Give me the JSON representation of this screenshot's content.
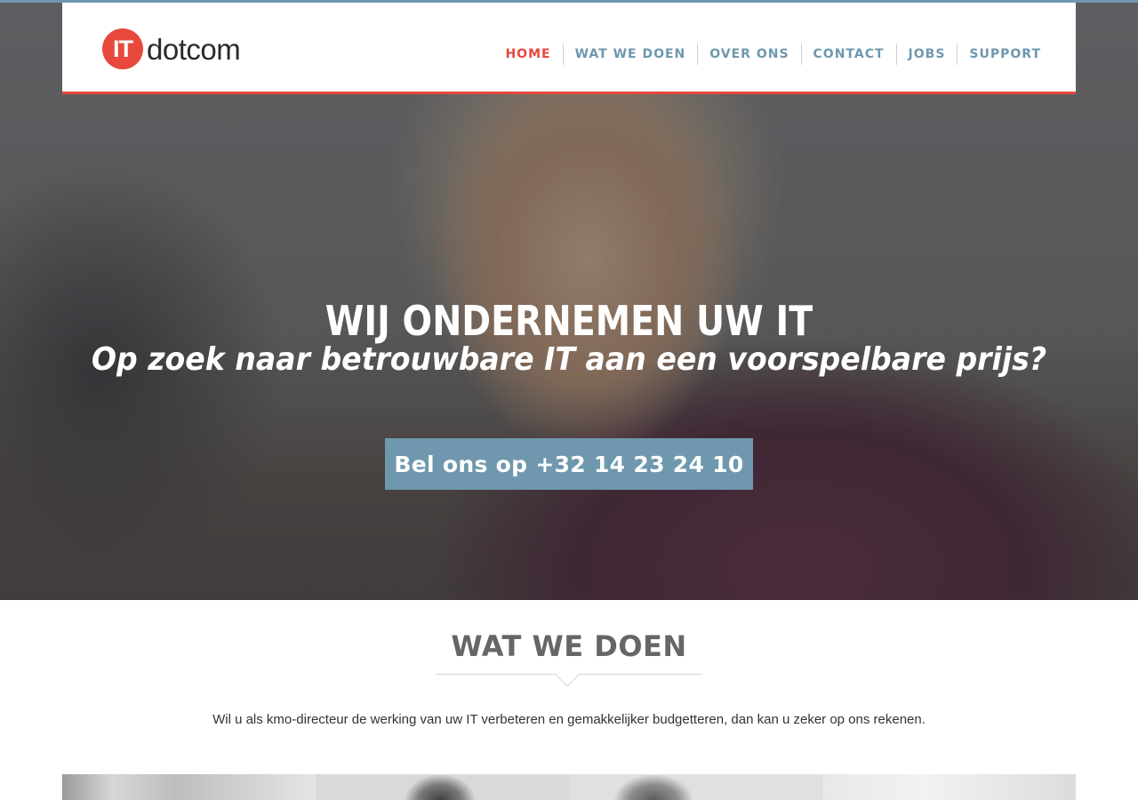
{
  "logo": {
    "badge": "IT",
    "word": "dotcom"
  },
  "nav": {
    "items": [
      {
        "label": "HOME",
        "active": true
      },
      {
        "label": "WAT WE DOEN",
        "active": false
      },
      {
        "label": "OVER ONS",
        "active": false
      },
      {
        "label": "CONTACT",
        "active": false
      },
      {
        "label": "JOBS",
        "active": false
      },
      {
        "label": "SUPPORT",
        "active": false
      }
    ]
  },
  "hero": {
    "title": "WIJ ONDERNEMEN UW IT",
    "subtitle": "Op zoek naar betrouwbare IT aan een voorspelbare prijs?",
    "cta_label": "Bel ons op +32 14 23 24 10"
  },
  "section": {
    "title": "WAT WE DOEN",
    "text": "Wil u als kmo-directeur de werking van uw IT verbeteren en gemakkelijker budgetteren, dan kan u zeker op ons rekenen."
  },
  "colors": {
    "accent": "#e8483c",
    "nav_blue": "#6f98ae"
  }
}
